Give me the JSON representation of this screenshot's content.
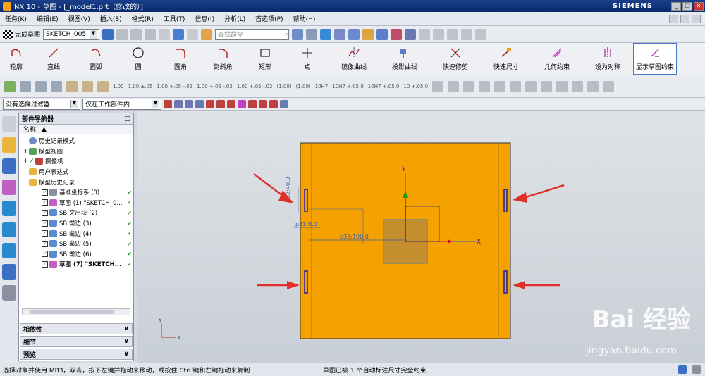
{
  "window": {
    "title": "NX 10 - 草图 - [_model1.prt（修改的）]",
    "brand": "SIEMENS"
  },
  "menu": [
    "任务(K)",
    "编辑(E)",
    "视图(V)",
    "插入(S)",
    "格式(R)",
    "工具(T)",
    "信息(I)",
    "分析(L)",
    "首选项(P)",
    "帮助(H)"
  ],
  "toolbar": {
    "finish_label": "完成草图",
    "sketch_name": "SKETCH_005",
    "search_placeholder": "查找命令"
  },
  "sketch_tools": [
    {
      "label": "轮廓",
      "icon": "profile-icon"
    },
    {
      "label": "直线",
      "icon": "line-icon"
    },
    {
      "label": "圆弧",
      "icon": "arc-icon"
    },
    {
      "label": "圆",
      "icon": "circle-icon"
    },
    {
      "label": "圆角",
      "icon": "fillet-icon"
    },
    {
      "label": "倒斜角",
      "icon": "chamfer-icon"
    },
    {
      "label": "矩形",
      "icon": "rectangle-icon"
    },
    {
      "label": "点",
      "icon": "point-icon"
    },
    {
      "label": "镜像曲线",
      "icon": "mirror-curve-icon"
    },
    {
      "label": "投影曲线",
      "icon": "project-curve-icon"
    },
    {
      "label": "快速修剪",
      "icon": "quick-trim-icon"
    },
    {
      "label": "快速尺寸",
      "icon": "rapid-dimension-icon"
    },
    {
      "label": "几何约束",
      "icon": "geometric-constraint-icon"
    },
    {
      "label": "设为对称",
      "icon": "make-symmetric-icon"
    },
    {
      "label": "显示草图约束",
      "icon": "show-constraints-icon"
    }
  ],
  "tolerance_labels": [
    "1.00",
    "1.00 ±.05",
    "1.00 +.05 -.02",
    "1.00 +.05 -.02",
    "1.00 +.05 -.02",
    "(1.00)",
    "(1.00)",
    "10H7",
    "10H7 +.05 0",
    "10H7 +.05 0",
    "10 +.05 0"
  ],
  "filters": {
    "selection_filter": "没有选择过滤器",
    "scope": "仅在工作部件内"
  },
  "navigator": {
    "title": "部件导航器",
    "column": "名称",
    "items": [
      {
        "label": "历史记录模式",
        "indent": 1,
        "check": false,
        "ok": false
      },
      {
        "label": "模型视图",
        "indent": 0,
        "check": false,
        "ok": false
      },
      {
        "label": "摄像机",
        "indent": 0,
        "check": true,
        "ok": false
      },
      {
        "label": "用户表达式",
        "indent": 1,
        "check": false,
        "ok": false
      },
      {
        "label": "模型历史记录",
        "indent": 0,
        "check": false,
        "ok": false
      },
      {
        "label": "基准坐标系 (0)",
        "indent": 2,
        "check": true,
        "ok": true
      },
      {
        "label": "草图 (1) \"SKETCH_0...",
        "indent": 2,
        "check": true,
        "ok": true
      },
      {
        "label": "SB 突出块 (2)",
        "indent": 2,
        "check": true,
        "ok": true
      },
      {
        "label": "SB 凿边 (3)",
        "indent": 2,
        "check": true,
        "ok": true
      },
      {
        "label": "SB 凿边 (4)",
        "indent": 2,
        "check": true,
        "ok": true
      },
      {
        "label": "SB 凿边 (5)",
        "indent": 2,
        "check": true,
        "ok": true
      },
      {
        "label": "SB 凿边 (6)",
        "indent": 2,
        "check": true,
        "ok": true
      },
      {
        "label": "草图 (7) \"SKETCH...",
        "indent": 2,
        "check": true,
        "ok": true
      }
    ],
    "panels": [
      "相依性",
      "细节",
      "预览"
    ]
  },
  "canvas": {
    "dims": [
      "p32:40.0",
      "p31:6.0",
      "p33:190.0"
    ],
    "axis_x": "X",
    "axis_y": "Y",
    "colors": {
      "plate": "#f5a100",
      "arrow": "#e0302a",
      "dim": "#3a5fb0"
    }
  },
  "status": {
    "left": "选择对象并使用 MB3，双击，按下左键并拖动来移动，或按住 Ctrl 键和左键拖动来复制",
    "right": "草图已被 1 个自动标注尺寸完全约束"
  },
  "watermark": {
    "main": "Bai 经验",
    "sub": "jingyan.baidu.com"
  }
}
